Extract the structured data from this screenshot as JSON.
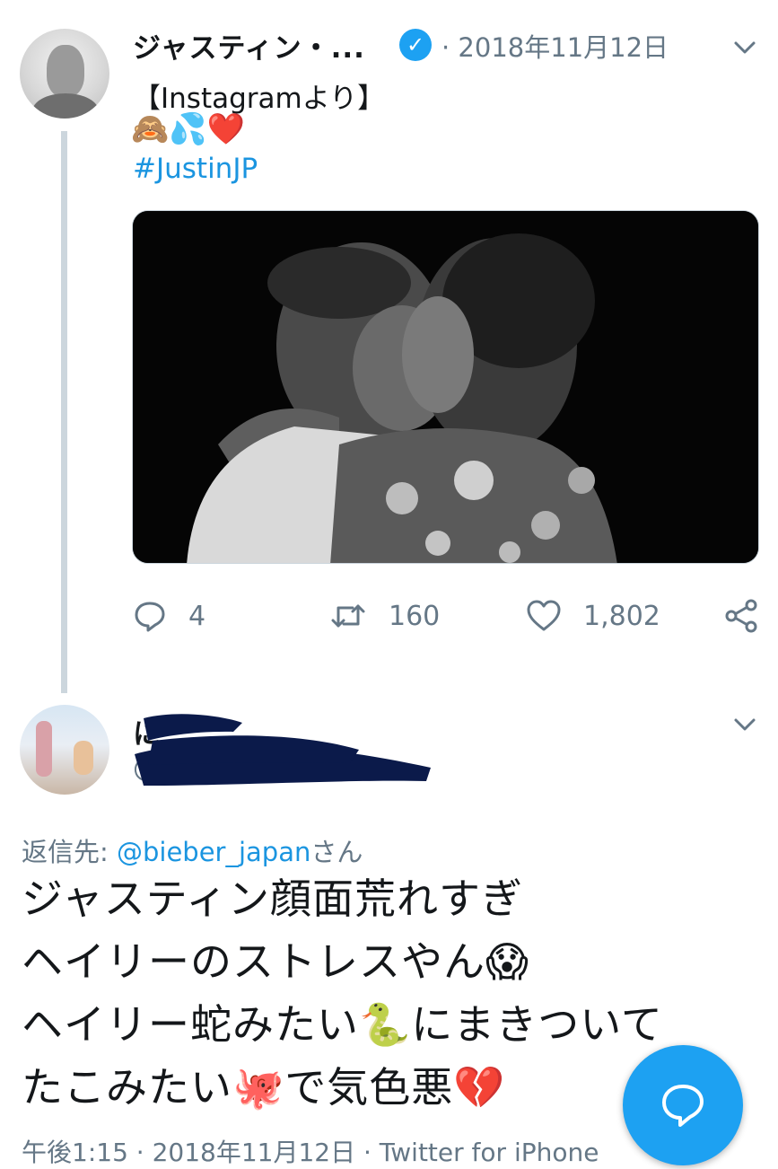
{
  "tweet": {
    "author_name": "ジャスティン・...",
    "verified": true,
    "date": "· 2018年11月12日",
    "text_line1": "【Instagramより】",
    "emojis": "🙈💦❤️",
    "hashtag": "#JustinJP",
    "stats": {
      "replies": "4",
      "retweets": "160",
      "likes": "1,802"
    }
  },
  "reply": {
    "author_name": "に",
    "handle": "@",
    "reply_to_label": "返信先: ",
    "reply_to_mention": "@bieber_japan",
    "reply_to_suffix": "さん",
    "lines": [
      "ジャスティン顔面荒れすぎ",
      "ヘイリーのストレスやん😱",
      "ヘイリー蛇みたい🐍にまきついて",
      "たこみたい🐙で気色悪💔"
    ],
    "footer": "午後1:15 · 2018年11月12日 · Twitter for iPhone"
  },
  "colors": {
    "accent": "#1da1f2",
    "link": "#1b95e0",
    "secondary_text": "#657786",
    "primary_text": "#14171a",
    "like_red": "#e0245e",
    "scribble": "#0b1a4a"
  },
  "icons": {
    "reply": "reply-icon",
    "retweet": "retweet-icon",
    "like": "heart-icon",
    "share": "share-icon",
    "more": "chevron-down-icon",
    "compose": "compose-reply-icon"
  }
}
